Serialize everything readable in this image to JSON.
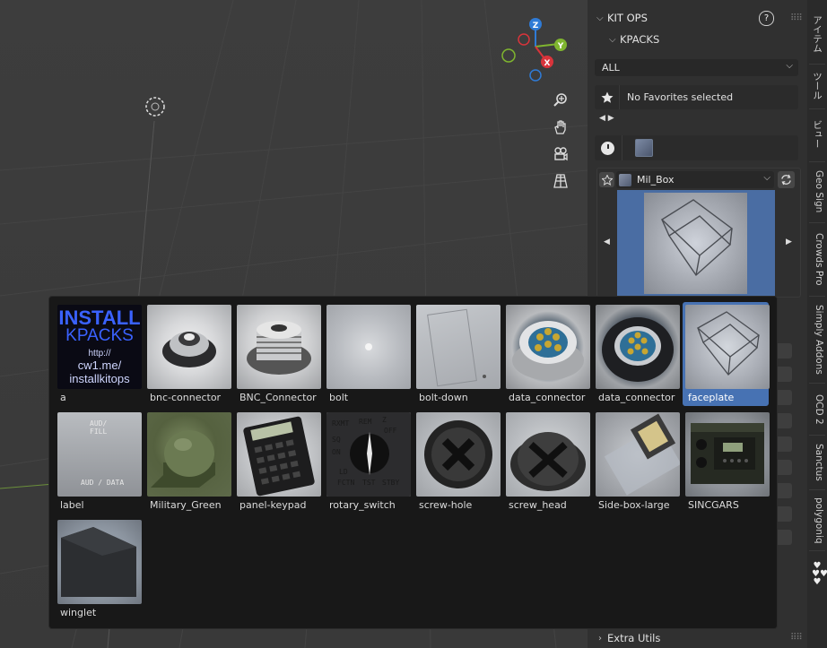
{
  "viewport": {
    "gizmo_axes": {
      "z": "Z",
      "y": "Y",
      "x": "X"
    },
    "colors": {
      "z": "#2f7bd6",
      "y": "#7fb52f",
      "x": "#d8343b"
    }
  },
  "npanel": {
    "header_title": "KIT OPS",
    "help_label": "?",
    "subheader_title": "KPACKS",
    "filter_value": "ALL",
    "favorites_text": "No Favorites selected",
    "arrows": "◀ ▶",
    "current_asset": "Mil_Box",
    "extra_section": "Extra Utils"
  },
  "tabs": [
    "アイテム",
    "ツール",
    "ビュー",
    "Geo Sign",
    "Crowds Pro",
    "Simply Addons",
    "OCD 2",
    "Sanctus",
    "polygoniq"
  ],
  "popup": {
    "tiles": [
      {
        "label": "a",
        "install": [
          "INSTALL",
          "KPACKS",
          "http://",
          "cw1.me/",
          "installkitops"
        ]
      },
      {
        "label": "bnc-connector"
      },
      {
        "label": "BNC_Connector"
      },
      {
        "label": "bolt"
      },
      {
        "label": "bolt-down"
      },
      {
        "label": "data_connector"
      },
      {
        "label": "data_connector"
      },
      {
        "label": "faceplate",
        "selected": true
      },
      {
        "label": "label",
        "top_text": "AUD/\nFILL",
        "bottom_text": "AUD / DATA"
      },
      {
        "label": "Military_Green"
      },
      {
        "label": "panel-keypad"
      },
      {
        "label": "rotary_switch",
        "dial_text": [
          "RXMT",
          "REM",
          "OFF",
          "SQ",
          "ON",
          "LD",
          "FCTN",
          "TST",
          "STBY",
          "Z"
        ]
      },
      {
        "label": "screw-hole"
      },
      {
        "label": "screw_head"
      },
      {
        "label": "Side-box-large"
      },
      {
        "label": "SINCGARS"
      },
      {
        "label": "winglet"
      }
    ]
  }
}
